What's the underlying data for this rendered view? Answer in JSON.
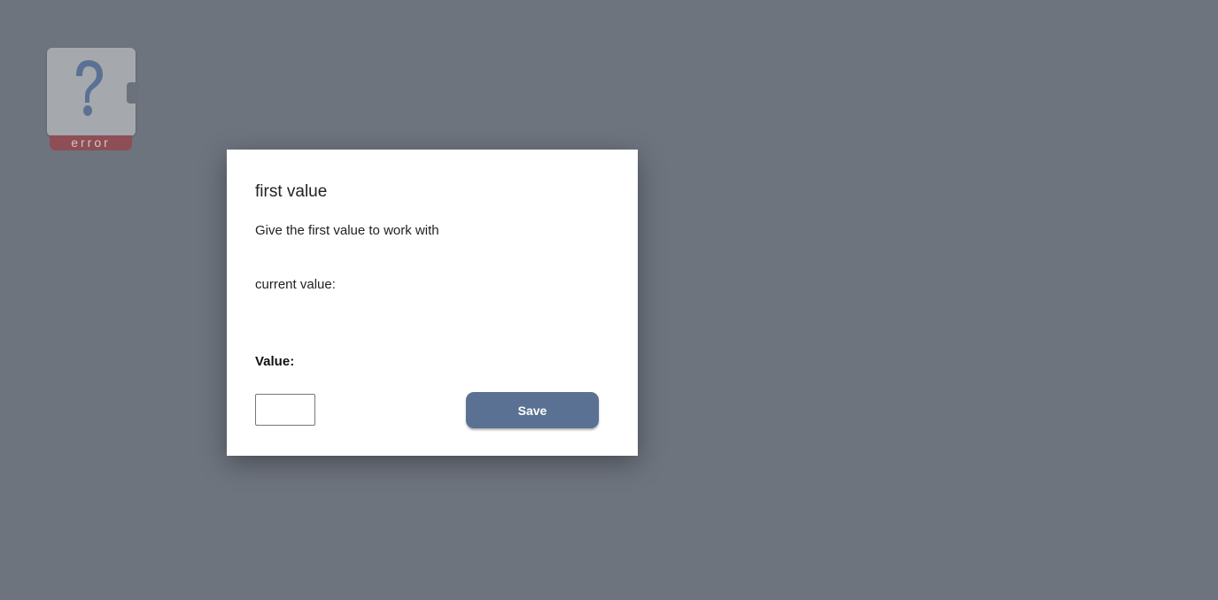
{
  "canvas": {
    "node": {
      "icon": "question-mark-icon",
      "status_label": "error"
    }
  },
  "dialog": {
    "title": "first value",
    "description": "Give the first value to work with",
    "current_value_label": "current value:",
    "value_label": "Value:",
    "value_input": {
      "value": "",
      "placeholder": ""
    },
    "save_label": "Save"
  },
  "colors": {
    "overlay": "#6e747e",
    "accent": "#5a7193",
    "error": "#8e4e55"
  }
}
